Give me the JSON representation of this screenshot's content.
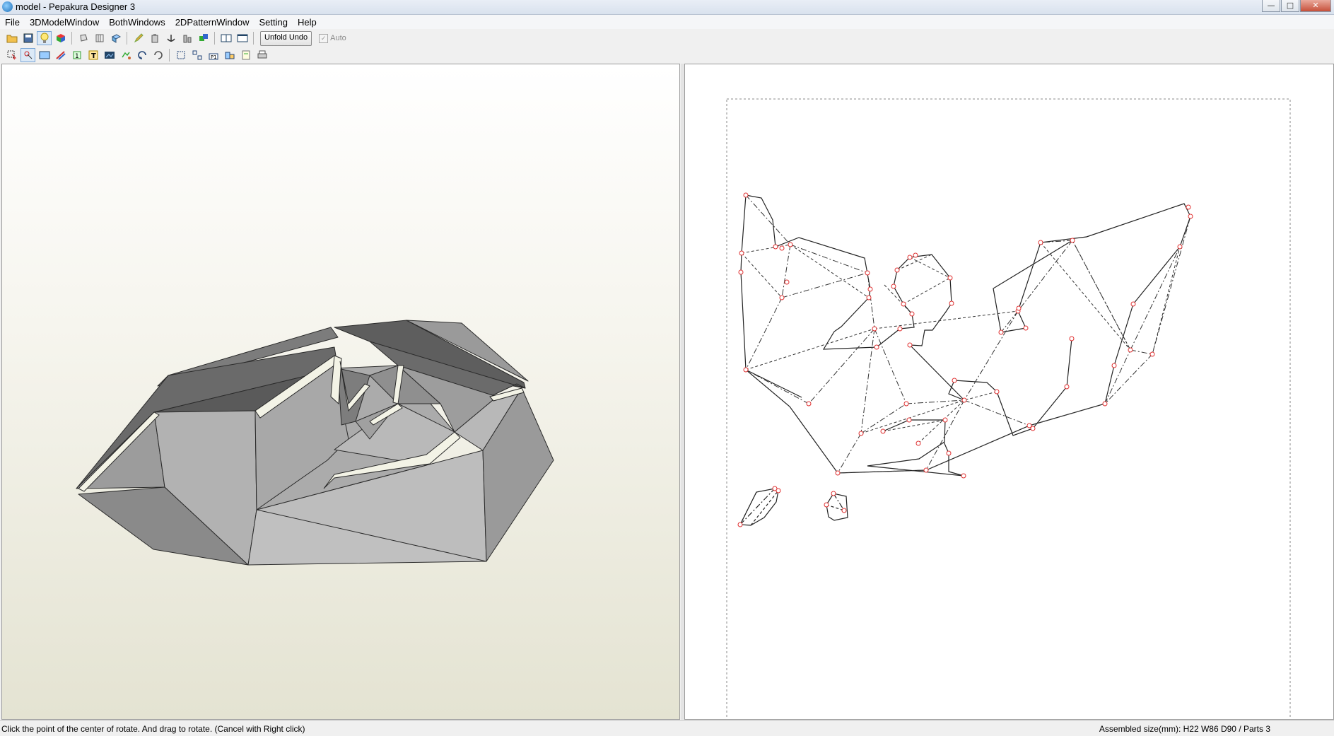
{
  "window": {
    "title": "model - Pepakura Designer 3",
    "icon": "pepakura-app-icon"
  },
  "window_controls": {
    "minimize": "—",
    "maximize": "□",
    "close": "✕"
  },
  "menu": [
    "File",
    "3DModelWindow",
    "BothWindows",
    "2DPatternWindow",
    "Setting",
    "Help"
  ],
  "toolbar1": {
    "icons": [
      "open-folder-icon",
      "save-icon",
      "light-bulb-icon",
      "color-cube-icon",
      "rotate-3d-icon",
      "paper-stack-icon",
      "cube-view-icon",
      "pencil-icon",
      "glue-icon",
      "anchor-icon",
      "bar-chart-icon",
      "join-icon",
      "single-window-icon",
      "dual-window-icon"
    ],
    "unfold_undo_label": "Unfold Undo",
    "auto_label": "Auto"
  },
  "toolbar2": {
    "icons": [
      "select-icon",
      "rotate-point-icon",
      "view-frame-icon",
      "edge-tool-icon",
      "text-tool-icon",
      "image-tool-icon",
      "fold-tool-icon",
      "undo-icon",
      "redo-icon",
      "fit-icon",
      "arrange-icon",
      "number-icon",
      "layout-icon",
      "paper-icon",
      "print-icon"
    ]
  },
  "status": {
    "hint": "Click the point of the center of rotate. And drag to rotate. (Cancel with Right click)",
    "assembled": "Assembled size(mm): H22 W86 D90 / Parts 3"
  }
}
